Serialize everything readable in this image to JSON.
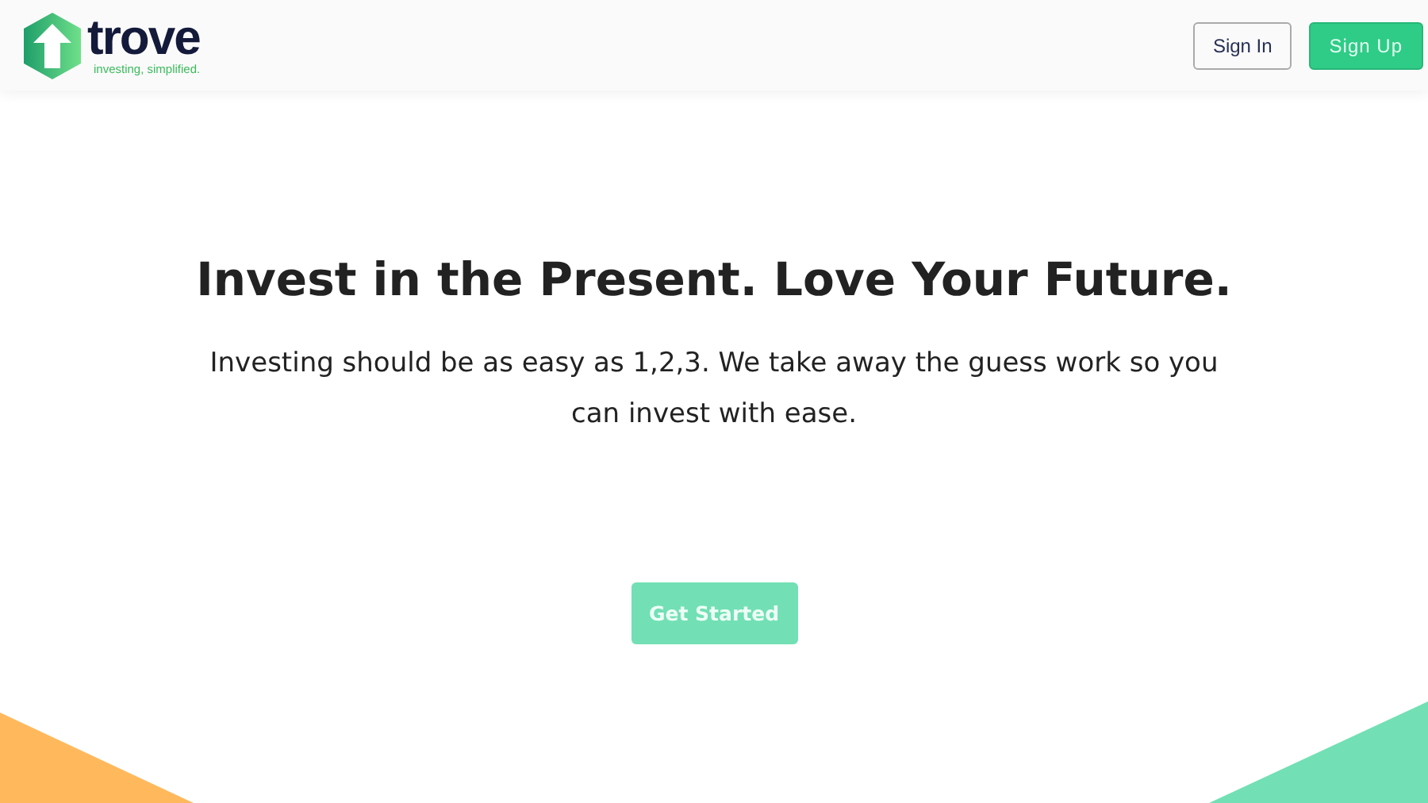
{
  "header": {
    "logo": {
      "name": "trove",
      "tagline": "investing, simplified."
    },
    "buttons": [
      {
        "label": "Sign In",
        "kind": "outline"
      },
      {
        "label": "Sign Up",
        "kind": "primary"
      }
    ]
  },
  "hero": {
    "title": "Invest in the Present. Love Your Future.",
    "text": "Investing should be as easy as 1,2,3. We take away the guess work so you can invest with ease.",
    "button": "Get Started"
  }
}
